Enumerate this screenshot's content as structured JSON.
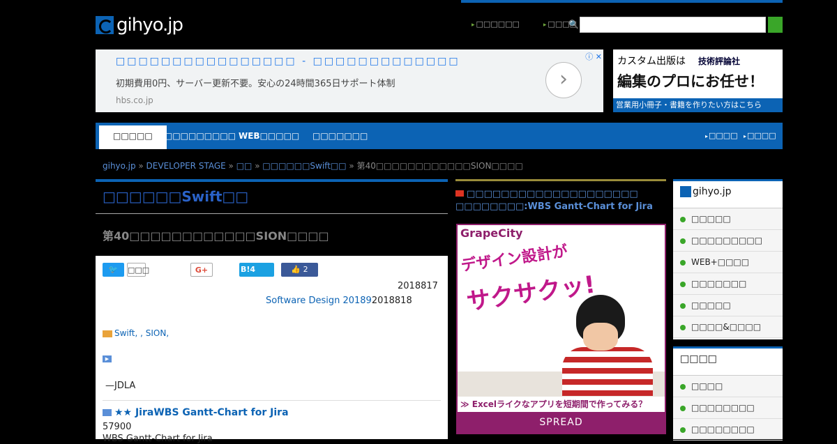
{
  "header": {
    "logo_text": "gihyo.jp",
    "links": [
      "□□□□□□",
      "□□□□"
    ],
    "search_placeholder": ""
  },
  "ad": {
    "title": "□□□□□□□□□□□□□□□□ - □□□□□□□□□□□□□",
    "desc": "初期費用0円、サーバー更新不要。安心の24時間365日サポート体制",
    "url": "hbs.co.jp",
    "info": "ⓘ ✕"
  },
  "banner": {
    "line1": "カスタム出版は",
    "brand": "技術評論社",
    "line2": "編集のプロにお任せ！",
    "footer": "営業用小冊子・書籍を作りたい方はこちら"
  },
  "nav": {
    "items": [
      "□□□□□",
      "□□□□□□□□□",
      "WEB□□□□□",
      "□□□□□□□"
    ],
    "right": [
      "□□□□",
      "□□□□"
    ]
  },
  "breadcrumb": {
    "home": "gihyo.jp",
    "stage": "DEVELOPER STAGE",
    "cat": "□□",
    "series": "□□□□□□Swift□□",
    "current": "第40□□□□□□□□□□□□SION□□□□"
  },
  "article": {
    "series_title": "□□□□□□Swift□□",
    "subtitle": "第40□□□□□□□□□□□□SION□□□□",
    "tweet_label": "🐦",
    "tweet_count": "□□□",
    "gplus_label": "G+",
    "hatena_label": "B!4",
    "fb_count": "👍 2",
    "date1": "2018817",
    "date2_link": "Software Design 20189",
    "date2_tail": "2018818",
    "tags": "Swift, , SION,",
    "quote": "—JDLA",
    "related_title": "★★ JiraWBS Gantt-Chart for Jira",
    "related_num": "57900",
    "related_name": "WBS Gantt-Chart for Jira"
  },
  "sponsor": {
    "title_line1": "□□□□□□□□□□□□□□□□□□□□",
    "title_line2": "□□□□□□□□:WBS Gantt-Chart for Jira",
    "brand": "GrapeCity",
    "catch1": "デザイン設計が",
    "catch2": "サクサクッ!",
    "cta": "≫ Excelライクなアプリを短期間で作ってみる？",
    "footer": "SPREAD"
  },
  "sidebar": {
    "box1_title": "gihyo.jp",
    "box1_items": [
      "□□□□□",
      "□□□□□□□□□",
      "WEB+□□□□",
      "□□□□□□□",
      "□□□□□",
      "□□□□&□□□□"
    ],
    "box2_title": "□□□□",
    "box2_items": [
      "□□□□",
      "□□□□□□□□",
      "□□□□□□□□"
    ]
  }
}
